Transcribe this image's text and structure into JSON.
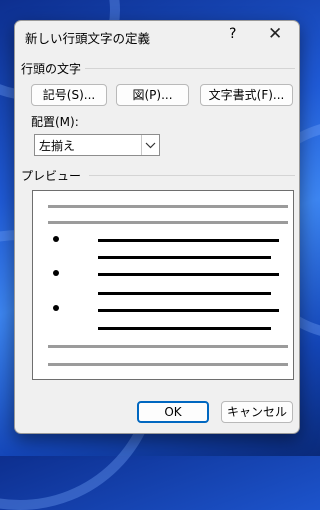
{
  "dialog": {
    "title": "新しい行頭文字の定義",
    "help": "?",
    "close": "✕"
  },
  "bullet_group": {
    "label": "行頭の文字",
    "symbol_button": "記号(S)...",
    "picture_button": "図(P)...",
    "font_button": "文字書式(F)..."
  },
  "alignment": {
    "label": "配置(M):",
    "value": "左揃え"
  },
  "preview": {
    "label": "プレビュー",
    "bullet_glyph": "●"
  },
  "footer": {
    "ok": "OK",
    "cancel": "キャンセル"
  },
  "colors": {
    "accent": "#0067c0"
  }
}
